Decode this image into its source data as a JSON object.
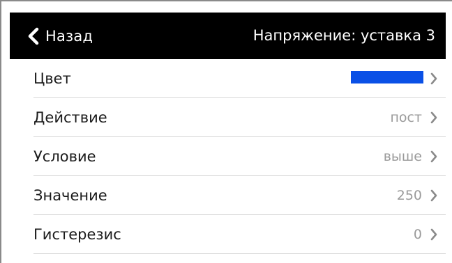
{
  "header": {
    "back_label": "Назад",
    "title": "Напряжение: уставка 3"
  },
  "rows": [
    {
      "label": "Цвет",
      "value": "",
      "swatch_color": "#0a50e6"
    },
    {
      "label": "Действие",
      "value": "пост"
    },
    {
      "label": "Условие",
      "value": "выше"
    },
    {
      "label": "Значение",
      "value": "250"
    },
    {
      "label": "Гистерезис",
      "value": "0"
    }
  ],
  "icons": {
    "back": "chevron-left-icon",
    "row_arrow": "chevron-right-icon"
  },
  "colors": {
    "header_bg": "#000000",
    "header_text": "#ffffff",
    "label_text": "#1a1a1a",
    "value_text": "#9a9a9a",
    "separator": "#dcdcdc"
  }
}
